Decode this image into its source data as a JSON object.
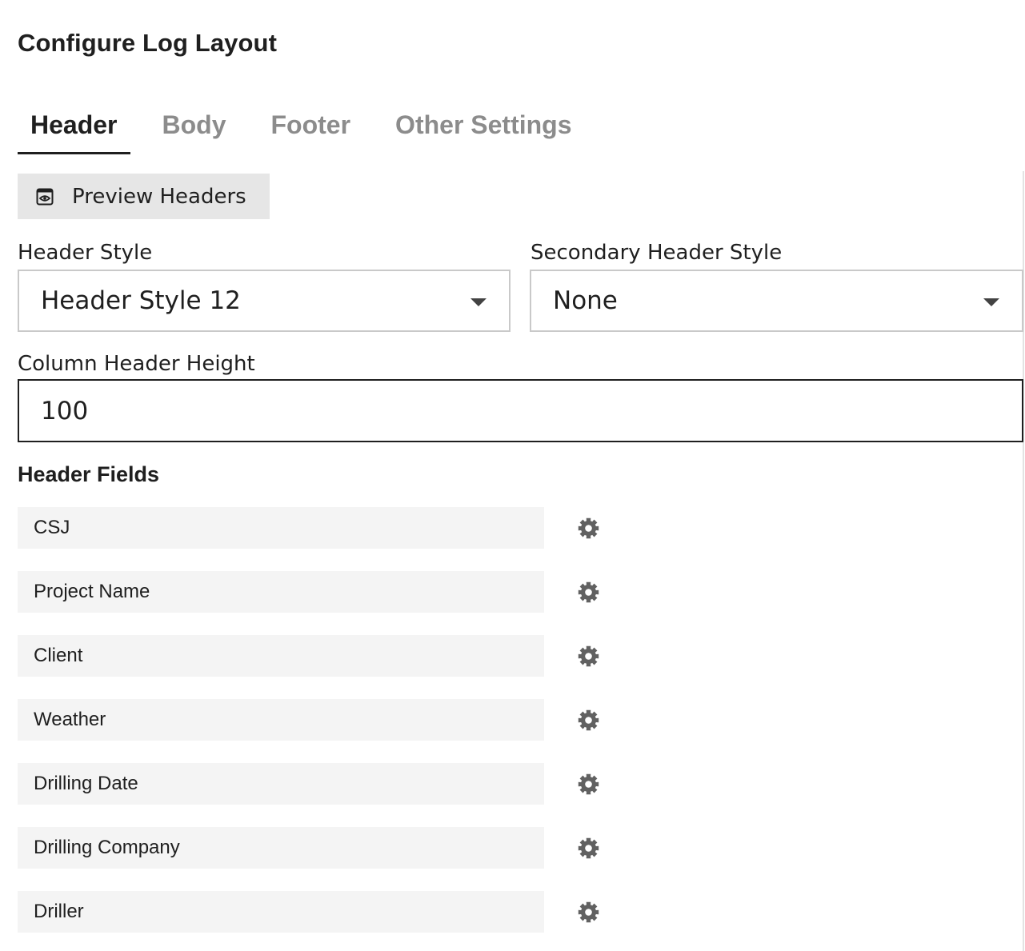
{
  "page": {
    "title": "Configure Log Layout"
  },
  "tabs": [
    {
      "label": "Header",
      "active": true
    },
    {
      "label": "Body",
      "active": false
    },
    {
      "label": "Footer",
      "active": false
    },
    {
      "label": "Other Settings",
      "active": false
    }
  ],
  "preview": {
    "label": "Preview Headers",
    "icon": "preview-eye-icon"
  },
  "header_style": {
    "label": "Header Style",
    "value": "Header Style 12"
  },
  "secondary_header_style": {
    "label": "Secondary Header Style",
    "value": "None"
  },
  "column_header_height": {
    "label": "Column Header Height",
    "value": "100"
  },
  "header_fields": {
    "title": "Header Fields",
    "items": [
      {
        "label": "CSJ",
        "icon": "gear-icon"
      },
      {
        "label": "Project Name",
        "icon": "gear-icon"
      },
      {
        "label": "Client",
        "icon": "gear-icon"
      },
      {
        "label": "Weather",
        "icon": "gear-icon"
      },
      {
        "label": "Drilling Date",
        "icon": "gear-icon"
      },
      {
        "label": "Drilling Company",
        "icon": "gear-icon"
      },
      {
        "label": "Driller",
        "icon": "gear-icon"
      }
    ]
  },
  "colors": {
    "text": "#1f1f1f",
    "tab_inactive": "#8c8c8c",
    "button_bg": "#e6e6e6",
    "field_bg": "#f4f4f4",
    "icon": "#616161"
  }
}
